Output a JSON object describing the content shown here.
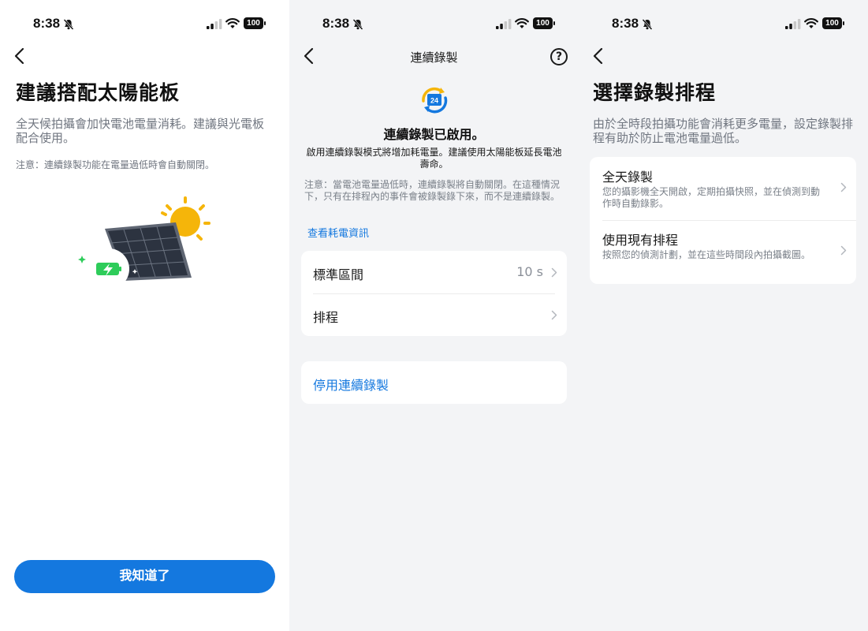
{
  "status_bar": {
    "time": "8:38",
    "battery": "100"
  },
  "screen1": {
    "title": "建議搭配太陽能板",
    "description": "全天候拍攝會加快電池電量消耗。建議與光電板配合使用。",
    "note": "注意：連續錄製功能在電量過低時會自動關閉。",
    "button_label": "我知道了"
  },
  "screen2": {
    "nav_title": "連續錄製",
    "help_symbol": "?",
    "icon_text": "24",
    "status_title": "連續錄製已啟用。",
    "body": "啟用連續錄製模式將增加耗電量。建議使用太陽能板延長電池壽命。",
    "note": "注意：當電池電量過低時，連續錄製將自動關閉。在這種情況下，只有在排程內的事件會被錄製錄下來，而不是連續錄製。",
    "link": "查看耗電資訊",
    "settings": [
      {
        "label": "標準區間",
        "value": "10 s"
      },
      {
        "label": "排程",
        "value": ""
      }
    ],
    "disable_label": "停用連續錄製"
  },
  "screen3": {
    "title": "選擇錄製排程",
    "description": "由於全時段拍攝功能會消耗更多電量，設定錄製排程有助於防止電池電量過低。",
    "options": [
      {
        "title": "全天錄製",
        "desc": "您的攝影機全天開啟，定期拍攝快照，並在偵測到動作時自動錄影。"
      },
      {
        "title": "使用現有排程",
        "desc": "按照您的偵測計劃，並在這些時間段內拍攝截圖。"
      }
    ]
  },
  "colors": {
    "accent": "#1478df",
    "charge_green": "#2ecc5a",
    "sun": "#f5b50a"
  }
}
